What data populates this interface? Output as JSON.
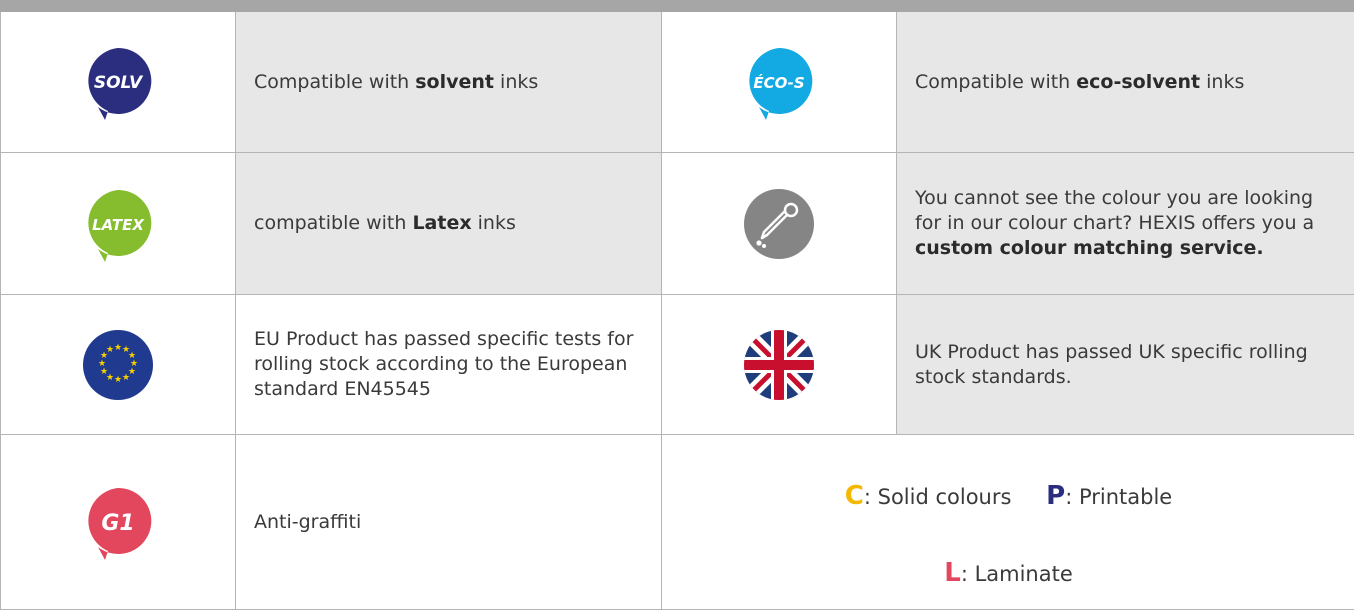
{
  "rows": [
    {
      "left": {
        "badge": "SOLV",
        "badge_color": "#2b2d7f",
        "text_prefix": "Compatible with ",
        "text_bold": "solvent",
        "text_suffix": " inks"
      },
      "right": {
        "badge": "ÉCO-S",
        "badge_color": "#13a9e2",
        "text_prefix": "Compatible with ",
        "text_bold": "eco-solvent",
        "text_suffix": " inks"
      }
    },
    {
      "left": {
        "badge": "LATEX",
        "badge_color": "#86bd2f",
        "text_prefix": "compatible with ",
        "text_bold": "Latex",
        "text_suffix": " inks"
      },
      "right": {
        "icon": "pipette-icon",
        "badge_color": "#858585",
        "text_prefix": "You cannot see the colour you are looking for in our colour chart? HEXIS offers you a ",
        "text_bold": "custom colour matching service.",
        "text_suffix": ""
      }
    },
    {
      "left": {
        "icon": "eu-flag-icon",
        "badge_color": "#1f3a8f",
        "text": "EU Product has passed specific tests for rolling stock according to the European standard EN45545"
      },
      "right": {
        "icon": "uk-flag-icon",
        "badge_color": "#1f3d7a",
        "text": "UK Product has passed UK specific rolling stock standards."
      }
    },
    {
      "left": {
        "badge": "G1",
        "badge_color": "#e2475d",
        "text": "Anti-graffiti"
      }
    }
  ],
  "legend": [
    {
      "letter": "C",
      "color": "#f5b800",
      "text": ": Solid colours"
    },
    {
      "letter": "P",
      "color": "#2b2d7f",
      "text": ": Printable"
    },
    {
      "letter": "L",
      "color": "#e2475d",
      "text": ": Laminate"
    }
  ]
}
